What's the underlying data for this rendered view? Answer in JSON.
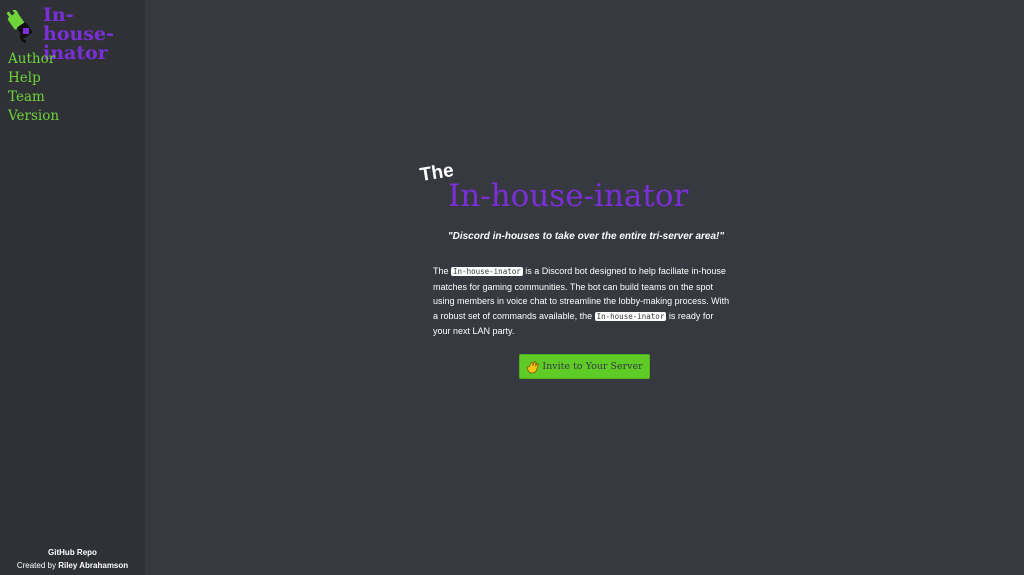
{
  "sidebar": {
    "brand_title": "In-house-inator",
    "nav": [
      {
        "label": "Author"
      },
      {
        "label": "Help"
      },
      {
        "label": "Team"
      },
      {
        "label": "Version"
      }
    ],
    "footer": {
      "repo_label": "GitHub Repo",
      "created_prefix": "Created by",
      "author_name": "Riley Abrahamson"
    }
  },
  "hero": {
    "the_label": "The",
    "title": "In-house-inator",
    "tagline": "\"Discord in-houses to take over the entire tri-server area!\"",
    "description": {
      "part1": "The",
      "code1": "In-house-inator",
      "part2": "is a Discord bot designed to help faciliate in-house matches for gaming communities. The bot can build teams on the spot using members in voice chat to streamline the lobby-making process. With a robust set of commands available, the",
      "code2": "In-house-inator",
      "part3": "is ready for your next LAN party."
    },
    "invite_button": "Invite to Your Server"
  },
  "colors": {
    "background": "#36393f",
    "sidebar": "#2f3136",
    "brand_purple": "#7b2fd6",
    "nav_green": "#6fd43a",
    "button_green": "#5ecb27"
  },
  "icons": {
    "logo": "plug-icon",
    "invite": "waving-hand-icon"
  }
}
